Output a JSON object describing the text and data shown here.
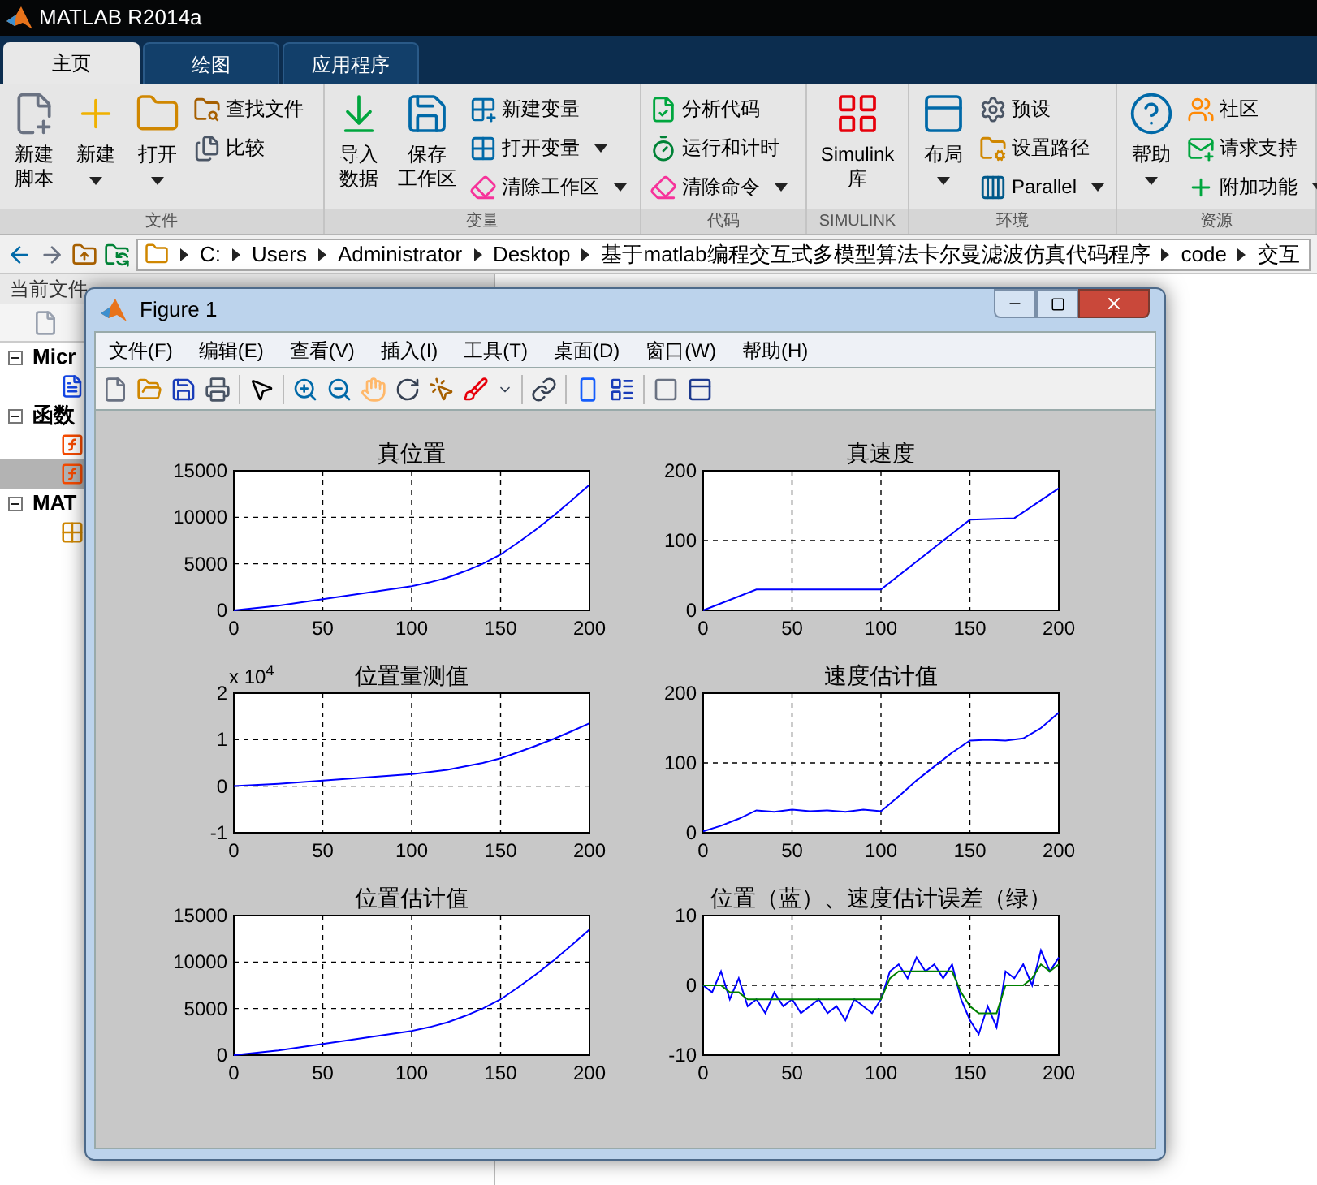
{
  "window": {
    "title": "MATLAB R2014a"
  },
  "tabs": [
    {
      "label": "主页",
      "selected": true
    },
    {
      "label": "绘图",
      "selected": false
    },
    {
      "label": "应用程序",
      "selected": false
    }
  ],
  "toolstrip": {
    "sections": [
      {
        "label": "文件",
        "large": [
          {
            "label": "新建脚本",
            "dropdown": false
          },
          {
            "label": "新建",
            "dropdown": true
          },
          {
            "label": "打开",
            "dropdown": true
          }
        ],
        "small": [
          {
            "label": "查找文件",
            "dropdown": false
          },
          {
            "label": "比较",
            "dropdown": false
          }
        ]
      },
      {
        "label": "变量",
        "large": [
          {
            "label": "导入数据",
            "dropdown": false
          },
          {
            "label": "保存工作区",
            "dropdown": false
          }
        ],
        "small": [
          {
            "label": "新建变量",
            "dropdown": false
          },
          {
            "label": "打开变量",
            "dropdown": true
          },
          {
            "label": "清除工作区",
            "dropdown": true
          }
        ]
      },
      {
        "label": "代码",
        "small": [
          {
            "label": "分析代码",
            "dropdown": false
          },
          {
            "label": "运行和计时",
            "dropdown": false
          },
          {
            "label": "清除命令",
            "dropdown": true
          }
        ]
      },
      {
        "label": "SIMULINK",
        "large": [
          {
            "label": "Simulink 库",
            "dropdown": false
          }
        ]
      },
      {
        "label": "环境",
        "large": [
          {
            "label": "布局",
            "dropdown": true
          }
        ],
        "small": [
          {
            "label": "预设",
            "dropdown": false
          },
          {
            "label": "设置路径",
            "dropdown": false
          },
          {
            "label": "Parallel",
            "dropdown": true
          }
        ]
      },
      {
        "label": "资源",
        "large": [
          {
            "label": "帮助",
            "dropdown": true
          }
        ],
        "small": [
          {
            "label": "社区",
            "dropdown": false
          },
          {
            "label": "请求支持",
            "dropdown": false
          },
          {
            "label": "附加功能",
            "dropdown": true
          }
        ]
      }
    ]
  },
  "address_bar": {
    "segments": [
      "C:",
      "Users",
      "Administrator",
      "Desktop",
      "基于matlab编程交互式多模型算法卡尔曼滤波仿真代码程序",
      "code",
      "交互"
    ]
  },
  "current_folder": {
    "title": "当前文件",
    "tree": [
      {
        "label": "Micr",
        "expanded": true,
        "children": [
          {
            "kind": "document",
            "selected": false
          }
        ]
      },
      {
        "label": "函数",
        "expanded": true,
        "children": [
          {
            "kind": "function",
            "selected": false
          },
          {
            "kind": "function",
            "selected": true
          }
        ]
      },
      {
        "label": "MAT",
        "expanded": true,
        "children": [
          {
            "kind": "data",
            "selected": false
          }
        ]
      }
    ]
  },
  "figure": {
    "title": "Figure 1",
    "menu": [
      "文件(F)",
      "编辑(E)",
      "查看(V)",
      "插入(I)",
      "工具(T)",
      "桌面(D)",
      "窗口(W)",
      "帮助(H)"
    ],
    "plots": [
      {
        "chart_data": {
          "type": "line",
          "title": "真位置",
          "grid": true,
          "xlim": [
            0,
            200
          ],
          "ylim": [
            0,
            15000
          ],
          "xticks": [
            0,
            50,
            100,
            150,
            200
          ],
          "yticks": [
            0,
            5000,
            10000,
            15000
          ],
          "x": [
            0,
            25,
            50,
            75,
            100,
            110,
            120,
            130,
            140,
            150,
            160,
            170,
            180,
            190,
            200
          ],
          "series": [
            {
              "color": "#0000ff",
              "values": [
                0,
                500,
                1200,
                1900,
                2600,
                3000,
                3500,
                4200,
                5000,
                6000,
                7300,
                8700,
                10200,
                11800,
                13500
              ]
            }
          ]
        }
      },
      {
        "chart_data": {
          "type": "line",
          "title": "真速度",
          "grid": true,
          "xlim": [
            0,
            200
          ],
          "ylim": [
            0,
            200
          ],
          "xticks": [
            0,
            50,
            100,
            150,
            200
          ],
          "yticks": [
            0,
            100,
            200
          ],
          "x": [
            0,
            30,
            100,
            150,
            175,
            200
          ],
          "series": [
            {
              "color": "#0000ff",
              "values": [
                0,
                30,
                30,
                130,
                132,
                175
              ]
            }
          ]
        }
      },
      {
        "exponent": {
          "base": "x 10",
          "power": "4"
        },
        "chart_data": {
          "type": "line",
          "title": "位置量测值",
          "grid": true,
          "xlim": [
            0,
            200
          ],
          "ylim": [
            -1,
            2
          ],
          "xticks": [
            0,
            50,
            100,
            150,
            200
          ],
          "yticks": [
            -1,
            0,
            1,
            2
          ],
          "x": [
            0,
            25,
            50,
            75,
            100,
            120,
            140,
            150,
            160,
            170,
            180,
            190,
            200
          ],
          "series": [
            {
              "color": "#0000ff",
              "values": [
                0,
                0.05,
                0.12,
                0.19,
                0.26,
                0.35,
                0.5,
                0.6,
                0.73,
                0.87,
                1.02,
                1.18,
                1.35
              ]
            }
          ]
        }
      },
      {
        "chart_data": {
          "type": "line",
          "title": "速度估计值",
          "grid": true,
          "xlim": [
            0,
            200
          ],
          "ylim": [
            0,
            200
          ],
          "xticks": [
            0,
            50,
            100,
            150,
            200
          ],
          "yticks": [
            0,
            100,
            200
          ],
          "x": [
            0,
            10,
            20,
            30,
            40,
            50,
            60,
            70,
            80,
            90,
            100,
            110,
            120,
            130,
            140,
            150,
            160,
            170,
            180,
            190,
            200
          ],
          "series": [
            {
              "color": "#0000ff",
              "values": [
                2,
                10,
                20,
                32,
                30,
                33,
                31,
                32,
                30,
                33,
                31,
                52,
                75,
                95,
                115,
                132,
                133,
                132,
                135,
                150,
                172
              ]
            }
          ]
        }
      },
      {
        "chart_data": {
          "type": "line",
          "title": "位置估计值",
          "grid": true,
          "xlim": [
            0,
            200
          ],
          "ylim": [
            0,
            15000
          ],
          "xticks": [
            0,
            50,
            100,
            150,
            200
          ],
          "yticks": [
            0,
            5000,
            10000,
            15000
          ],
          "x": [
            0,
            25,
            50,
            75,
            100,
            110,
            120,
            130,
            140,
            150,
            160,
            170,
            180,
            190,
            200
          ],
          "series": [
            {
              "color": "#0000ff",
              "values": [
                0,
                500,
                1200,
                1900,
                2600,
                3000,
                3500,
                4200,
                5000,
                6000,
                7300,
                8700,
                10200,
                11800,
                13500
              ]
            }
          ]
        }
      },
      {
        "chart_data": {
          "type": "line",
          "title": "位置（蓝）、速度估计误差（绿）",
          "grid": true,
          "xlim": [
            0,
            200
          ],
          "ylim": [
            -10,
            10
          ],
          "xticks": [
            0,
            50,
            100,
            150,
            200
          ],
          "yticks": [
            -10,
            0,
            10
          ],
          "x": [
            0,
            5,
            10,
            15,
            20,
            25,
            30,
            35,
            40,
            45,
            50,
            55,
            60,
            65,
            70,
            75,
            80,
            85,
            90,
            95,
            100,
            105,
            110,
            115,
            120,
            125,
            130,
            135,
            140,
            145,
            150,
            155,
            160,
            165,
            170,
            175,
            180,
            185,
            190,
            195,
            200
          ],
          "series": [
            {
              "color": "#0000ff",
              "values": [
                0,
                -1,
                2,
                -2,
                1,
                -3,
                -2,
                -4,
                -1,
                -3,
                -2,
                -4,
                -3,
                -2,
                -4,
                -3,
                -5,
                -2,
                -3,
                -4,
                -2,
                2,
                3,
                1,
                4,
                2,
                3,
                1,
                3,
                -2,
                -5,
                -7,
                -3,
                -6,
                2,
                1,
                3,
                0,
                5,
                2,
                4
              ]
            },
            {
              "color": "#008000",
              "values": [
                0,
                0,
                0,
                -1,
                -1,
                -2,
                -2,
                -2,
                -2,
                -2,
                -2,
                -2,
                -2,
                -2,
                -2,
                -2,
                -2,
                -2,
                -2,
                -2,
                -2,
                1,
                2,
                2,
                2,
                2,
                2,
                2,
                2,
                -1,
                -3,
                -4,
                -4,
                -4,
                0,
                0,
                0,
                1,
                3,
                2,
                3
              ]
            }
          ]
        }
      }
    ]
  }
}
